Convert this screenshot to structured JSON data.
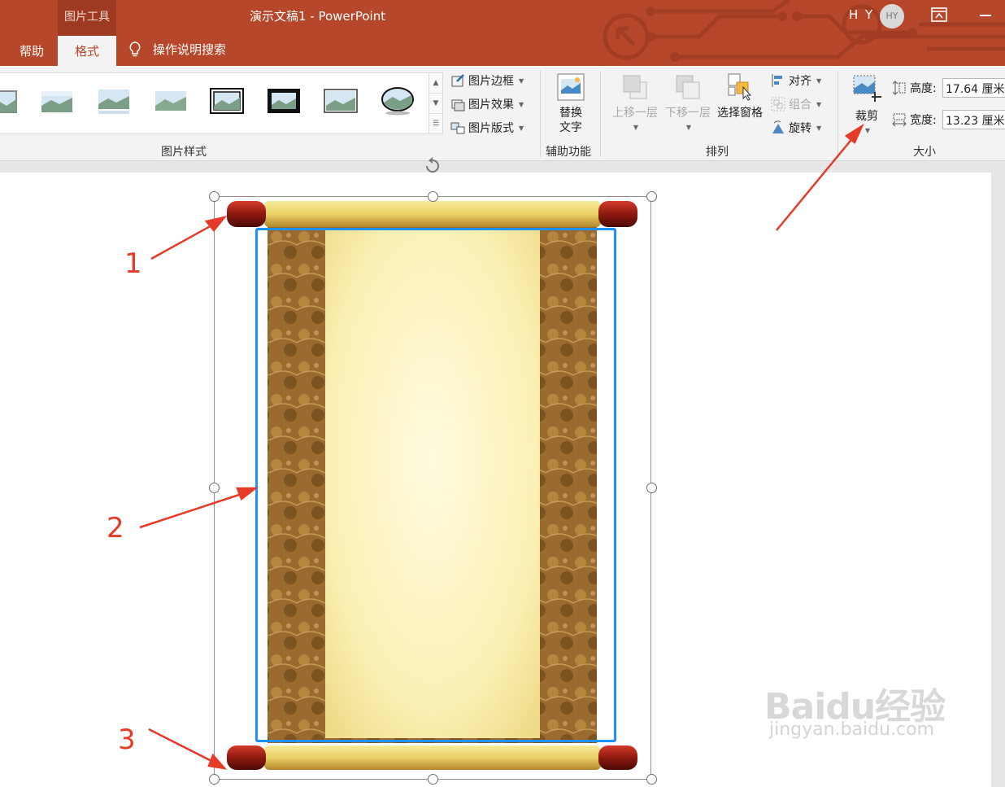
{
  "titlebar": {
    "context_group": "图片工具",
    "document_title": "演示文稿1 - PowerPoint",
    "user_name": "H Y",
    "avatar_initials": "HY",
    "bg_color": "#b7472a"
  },
  "tabs": [
    {
      "label": "帮助"
    },
    {
      "label": "格式",
      "active": true
    }
  ],
  "tell_me": {
    "label": "操作说明搜索"
  },
  "ribbon": {
    "picture_styles": {
      "label": "图片样式",
      "commands": [
        {
          "label": "图片边框",
          "icon": "picture-border-icon"
        },
        {
          "label": "图片效果",
          "icon": "picture-effects-icon"
        },
        {
          "label": "图片版式",
          "icon": "picture-layout-icon"
        }
      ]
    },
    "accessibility": {
      "label": "辅助功能",
      "alt_text_line1": "替换",
      "alt_text_line2": "文字"
    },
    "arrange": {
      "label": "排列",
      "bring_forward": "上移一层",
      "send_backward": "下移一层",
      "selection_pane": "选择窗格",
      "align": "对齐",
      "group": "组合",
      "rotate": "旋转"
    },
    "size": {
      "label": "大小",
      "crop": "裁剪",
      "height_label": "高度:",
      "height_value": "17.64 厘米",
      "width_label": "宽度:",
      "width_value": "13.23 厘米"
    }
  },
  "annotations": {
    "n1": "1",
    "n2": "2",
    "n3": "3",
    "color": "#e53b28"
  },
  "watermark": {
    "brand": "Baidu经验",
    "url": "jingyan.baidu.com"
  }
}
